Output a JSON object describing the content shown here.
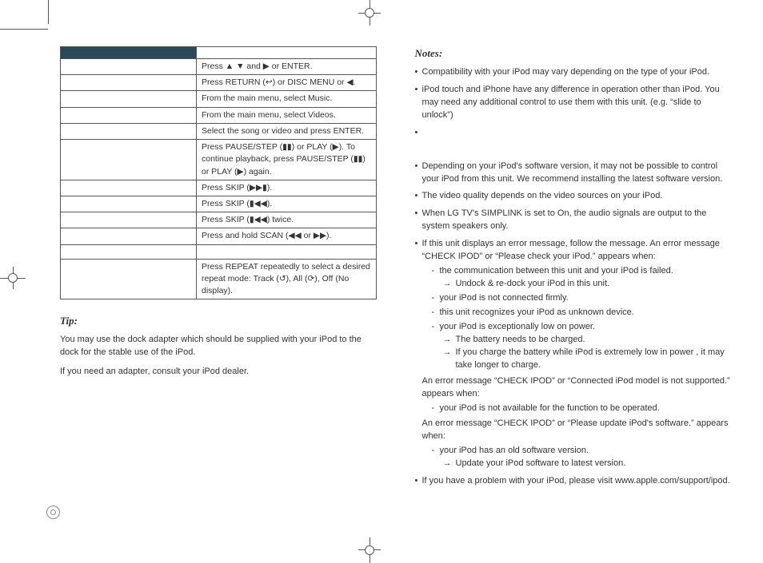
{
  "left": {
    "table_rows": [
      "Press ▲ ▼ and ▶ or ENTER.",
      "Press RETURN (↩) or DISC MENU or ◀.",
      "From the main menu, select Music.",
      "From the main menu, select Videos.",
      "Select the song or video and press ENTER.",
      "Press PAUSE/STEP (▮▮) or PLAY (▶). To continue playback, press PAUSE/STEP (▮▮) or PLAY (▶) again.",
      "Press SKIP (▶▶▮).",
      "Press SKIP (▮◀◀).",
      "Press SKIP (▮◀◀) twice.",
      "Press and hold SCAN (◀◀ or ▶▶).",
      "",
      "Press REPEAT repeatedly to select a desired repeat mode: Track (↺), All (⟳), Off (No display)."
    ],
    "tip_heading": "Tip:",
    "tip_p1": "You may use the dock adapter which should be supplied with your iPod to the dock for the stable use of the iPod.",
    "tip_p2": "If you need an adapter, consult your iPod dealer."
  },
  "right": {
    "notes_heading": "Notes:",
    "bullets": {
      "b1": "Compatibility with your iPod may vary depending on the type of your iPod.",
      "b2": "iPod touch and iPhone have any difference in operation other than iPod. You may need any additional control to use them with this unit. (e.g. “slide to unlock”)",
      "b3": "",
      "b4": "Depending on your iPod's software version, it may not be possible to control your iPod from this unit. We recommend installing the latest software version.",
      "b5": "The video quality depends on the video sources on your iPod.",
      "b6": "When LG TV's SIMPLINK is set to On, the audio signals are output to the system speakers only.",
      "b7_intro": "If this unit displays an error message, follow the message. An error message “CHECK IPOD” or “Please check your iPod.” appears when:",
      "b7_sub": {
        "s1": "the communication between this unit and your iPod is failed.",
        "s1_arrow": "Undock & re-dock your iPod in this unit.",
        "s2": "your iPod is not connected firmly.",
        "s3": "this unit recognizes your iPod as unknown device.",
        "s4": "your iPod is exceptionally low on power.",
        "s4_arrow1": "The battery needs to be charged.",
        "s4_arrow2": "If you charge the battery while iPod is extremely low in power , it may take longer to charge."
      },
      "b7_mid1": "An error message “CHECK IPOD” or “Connected iPod model is not supported.” appears when:",
      "b7_mid1_sub": "your iPod is not available for the function to be operated.",
      "b7_mid2": "An error message “CHECK IPOD” or “Please update iPod's software.” appears when:",
      "b7_mid2_sub": "your iPod has an old software version.",
      "b7_mid2_arrow": "Update your iPod software to latest version.",
      "b8": "If you have a problem with your iPod, please visit www.apple.com/support/ipod."
    }
  }
}
